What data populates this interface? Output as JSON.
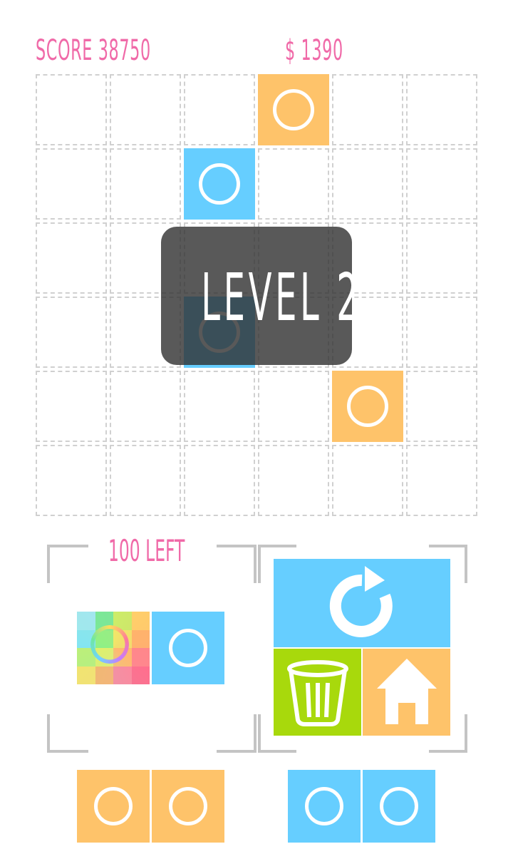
{
  "hud": {
    "score_text": "SCORE 38750",
    "money_text": "$ 1390"
  },
  "board": {
    "rows": 6,
    "cols": 6,
    "tiles": [
      {
        "row": 0,
        "col": 3,
        "color": "orange"
      },
      {
        "row": 1,
        "col": 2,
        "color": "blue"
      },
      {
        "row": 3,
        "col": 2,
        "color": "blue"
      },
      {
        "row": 4,
        "col": 4,
        "color": "orange"
      }
    ]
  },
  "overlay": {
    "level_text": "LEVEL  2"
  },
  "piece_panel": {
    "remaining_text": "100 LEFT"
  },
  "pieces": {
    "current": [
      "rainbow",
      "blue"
    ],
    "queue_left": [
      "orange",
      "orange"
    ],
    "queue_right": [
      "blue",
      "blue"
    ]
  },
  "colors": {
    "orange": "#fec36a",
    "blue": "#66ceff",
    "green": "#a8d90c",
    "text_pink": "#f06aa8"
  },
  "buttons": {
    "restart": "restart-icon",
    "trash": "trash-icon",
    "home": "home-icon"
  }
}
